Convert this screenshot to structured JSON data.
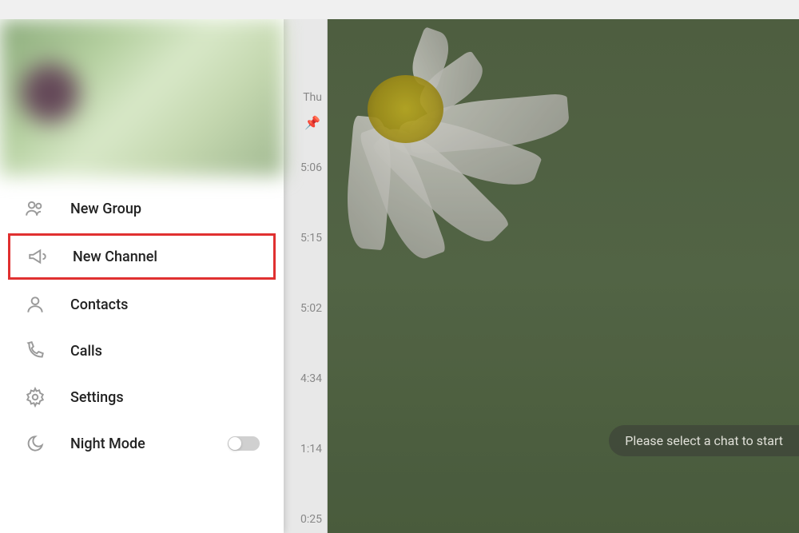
{
  "menu": {
    "items": [
      {
        "label": "New Group",
        "icon": "group"
      },
      {
        "label": "New Channel",
        "icon": "megaphone",
        "highlighted": true
      },
      {
        "label": "Contacts",
        "icon": "person"
      },
      {
        "label": "Calls",
        "icon": "phone"
      },
      {
        "label": "Settings",
        "icon": "gear"
      },
      {
        "label": "Night Mode",
        "icon": "moon",
        "toggle": true
      }
    ]
  },
  "chatList": {
    "dayLabel": "Thu",
    "times": [
      "5:06",
      "5:15",
      "5:02",
      "4:34",
      "1:14",
      "0:25"
    ]
  },
  "mainArea": {
    "promptText": "Please select a chat to start"
  }
}
